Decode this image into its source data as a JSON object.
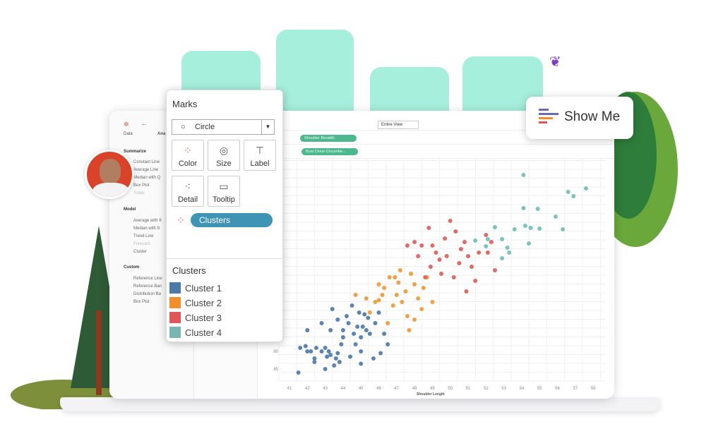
{
  "sidebar": {
    "tabs": [
      "Data",
      "Ana"
    ],
    "sections": [
      {
        "title": "Summarize",
        "items": [
          "Constant Line",
          "Average Line",
          "Median with Q",
          "Box Plot",
          "Totals"
        ]
      },
      {
        "title": "Model",
        "items": [
          "Average with 9",
          "Median with 9",
          "Trend Line",
          "Forecast",
          "Cluster"
        ]
      },
      {
        "title": "Custom",
        "items": [
          "Reference Line",
          "Reference Ban",
          "Distribution Ba",
          "Box Plot"
        ]
      }
    ]
  },
  "toolbar": {
    "view_select": "Entire View"
  },
  "shelves": {
    "columns_pill": "Shoulder Breadth",
    "rows_pill": "Bust Chest Circumfer..."
  },
  "marks": {
    "title": "Marks",
    "mark_type": "Circle",
    "buttons": [
      {
        "label": "Color",
        "icon": "color-dots-icon"
      },
      {
        "label": "Size",
        "icon": "size-icon"
      },
      {
        "label": "Label",
        "icon": "label-icon"
      },
      {
        "label": "Detail",
        "icon": "detail-icon"
      },
      {
        "label": "Tooltip",
        "icon": "tooltip-icon"
      }
    ],
    "color_pill": "Clusters"
  },
  "legend": {
    "title": "Clusters",
    "items": [
      {
        "label": "Cluster 1",
        "color": "#4e79a7"
      },
      {
        "label": "Cluster 2",
        "color": "#f28e2b"
      },
      {
        "label": "Cluster 3",
        "color": "#e15759"
      },
      {
        "label": "Cluster 4",
        "color": "#76b7b2"
      }
    ]
  },
  "show_me": {
    "label": "Show Me"
  },
  "chart_data": {
    "type": "scatter",
    "xlabel": "Shoulder Length",
    "x_ticks": [
      41,
      42,
      43,
      44,
      45,
      46,
      47,
      48,
      49,
      50,
      51,
      52,
      53,
      54,
      55,
      56,
      57,
      58
    ],
    "y_ticks": [
      85,
      90
    ],
    "xlim": [
      40.6,
      58.3
    ],
    "grid": true,
    "series": [
      {
        "name": "Cluster 1",
        "color": "#5b84b1",
        "points": [
          [
            41.5,
            84
          ],
          [
            41.6,
            91
          ],
          [
            41.9,
            91.5
          ],
          [
            42,
            90
          ],
          [
            42.2,
            90
          ],
          [
            42.5,
            91
          ],
          [
            42.4,
            88
          ],
          [
            42.4,
            87
          ],
          [
            42.8,
            90
          ],
          [
            43,
            91
          ],
          [
            43,
            85
          ],
          [
            43.1,
            88.5
          ],
          [
            43.2,
            90
          ],
          [
            43.3,
            89
          ],
          [
            43.5,
            86
          ],
          [
            43.6,
            88
          ],
          [
            43.7,
            89.5
          ],
          [
            43.8,
            87
          ],
          [
            44,
            96
          ],
          [
            44.3,
            98
          ],
          [
            44.4,
            88.5
          ],
          [
            44.6,
            95
          ],
          [
            44.8,
            97
          ],
          [
            45,
            94
          ],
          [
            45,
            90
          ],
          [
            45,
            86.5
          ],
          [
            45.1,
            97
          ],
          [
            45.3,
            96
          ],
          [
            45.5,
            95
          ],
          [
            45.7,
            88
          ],
          [
            46.1,
            89.5
          ],
          [
            46.5,
            92
          ],
          [
            43.7,
            99
          ],
          [
            44.2,
            100
          ],
          [
            44.9,
            101
          ],
          [
            45.4,
            99.5
          ],
          [
            44,
            94
          ],
          [
            43.3,
            96
          ],
          [
            42.8,
            98
          ],
          [
            43.9,
            92
          ],
          [
            44.7,
            92
          ],
          [
            45.2,
            100.5
          ],
          [
            42,
            96
          ],
          [
            46.3,
            95
          ],
          [
            43.4,
            102
          ],
          [
            45.8,
            98
          ],
          [
            44.5,
            103
          ],
          [
            46,
            101
          ]
        ]
      },
      {
        "name": "Cluster 2",
        "color": "#eda24a",
        "points": [
          [
            44.7,
            106
          ],
          [
            45.3,
            105
          ],
          [
            45.8,
            104
          ],
          [
            46,
            109
          ],
          [
            46.3,
            108
          ],
          [
            46.6,
            111
          ],
          [
            46.9,
            111
          ],
          [
            47,
            106
          ],
          [
            47.3,
            104
          ],
          [
            47.5,
            107
          ],
          [
            47.8,
            112
          ],
          [
            48,
            109
          ],
          [
            48.2,
            105
          ],
          [
            48.5,
            108
          ],
          [
            48.7,
            111
          ],
          [
            49,
            104
          ],
          [
            46,
            104.5
          ],
          [
            46.8,
            103
          ],
          [
            47.2,
            113
          ],
          [
            48.4,
            102
          ],
          [
            45.5,
            101
          ],
          [
            47.6,
            100
          ],
          [
            46.5,
            98
          ],
          [
            47.7,
            96
          ],
          [
            48,
            99
          ],
          [
            47.1,
            109.5
          ],
          [
            46.2,
            106
          ]
        ]
      },
      {
        "name": "Cluster 3",
        "color": "#e06a66",
        "points": [
          [
            47.6,
            120
          ],
          [
            48,
            121
          ],
          [
            48.4,
            120
          ],
          [
            48.8,
            125
          ],
          [
            49.2,
            118
          ],
          [
            49.4,
            116
          ],
          [
            49.7,
            122
          ],
          [
            50,
            127
          ],
          [
            50.3,
            124
          ],
          [
            50.6,
            119
          ],
          [
            50.8,
            121
          ],
          [
            51.2,
            114
          ],
          [
            51.4,
            110
          ],
          [
            51.6,
            118
          ],
          [
            52,
            123
          ],
          [
            52.3,
            121
          ],
          [
            52.5,
            113
          ],
          [
            50.5,
            115
          ],
          [
            49.5,
            112
          ],
          [
            48.9,
            114
          ],
          [
            50.2,
            111
          ],
          [
            49.8,
            117
          ],
          [
            51,
            117
          ],
          [
            48.2,
            117
          ],
          [
            49,
            120
          ],
          [
            50.9,
            107
          ],
          [
            52.1,
            118
          ],
          [
            48.6,
            111
          ]
        ]
      },
      {
        "name": "Cluster 4",
        "color": "#7cc2bd",
        "points": [
          [
            54.1,
            140
          ],
          [
            56.6,
            135.2
          ],
          [
            56.9,
            134
          ],
          [
            57.6,
            136.2
          ],
          [
            54.1,
            130.6
          ],
          [
            54.9,
            130.4
          ],
          [
            55.9,
            128.2
          ],
          [
            56.3,
            124.6
          ],
          [
            52.5,
            125.2
          ],
          [
            53.6,
            124.6
          ],
          [
            54.2,
            125.6
          ],
          [
            54.5,
            125
          ],
          [
            55,
            124.8
          ],
          [
            54.4,
            120.6
          ],
          [
            51.4,
            121.4
          ],
          [
            52.1,
            121.8
          ],
          [
            52,
            119.8
          ],
          [
            52.9,
            121.8
          ],
          [
            53.2,
            119.4
          ],
          [
            53.3,
            118
          ],
          [
            52.9,
            116.4
          ]
        ]
      }
    ]
  }
}
